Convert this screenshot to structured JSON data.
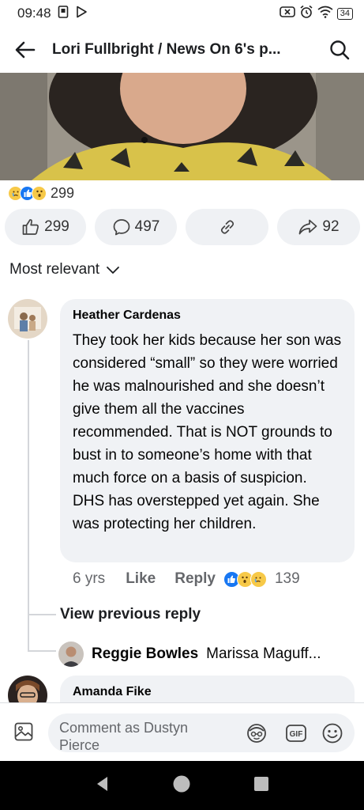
{
  "status_bar": {
    "time": "09:48",
    "battery": "34"
  },
  "header": {
    "title": "Lori Fullbright / News On 6's p..."
  },
  "reactions": {
    "count": "299",
    "types": [
      "sad-reaction-icon",
      "like-reaction-icon",
      "wow-reaction-icon"
    ]
  },
  "actions": {
    "like_count": "299",
    "comment_count": "497",
    "share_count": "92"
  },
  "sort": {
    "label": "Most relevant"
  },
  "comments": [
    {
      "author": "Heather Cardenas",
      "text": "They took her kids because her son was considered “small” so they were worried he was malnourished and she doesn’t give them all the vaccines recommended. That is NOT grounds to bust in to someone’s home with that much force on a basis of suspicion. DHS has overstepped yet again. She was protecting her children.",
      "age": "6 yrs",
      "like_label": "Like",
      "reply_label": "Reply",
      "reaction_count": "139",
      "view_previous_label": "View previous reply",
      "reply_preview": {
        "author": "Reggie Bowles",
        "text": "Marissa Maguff..."
      }
    },
    {
      "author": "Amanda Fike"
    }
  ],
  "composer": {
    "placeholder": "Comment as Dustyn Pierce"
  },
  "colors": {
    "like_blue": "#1877f2",
    "reaction_yellow": "#f7c948",
    "bubble_gray": "#f0f2f5"
  }
}
